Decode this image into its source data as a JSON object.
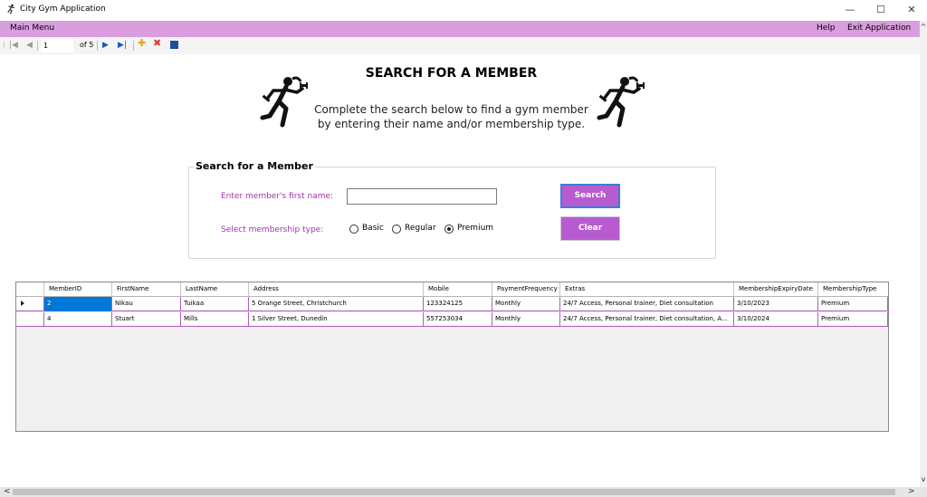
{
  "window": {
    "title": "City Gym Application",
    "icon": "runner-icon",
    "controls": {
      "minimize": "—",
      "maximize": "☐",
      "close": "✕"
    }
  },
  "menu": {
    "main": "Main Menu",
    "help": "Help",
    "exit": "Exit Application"
  },
  "navigator": {
    "position": "1",
    "count_label": "of 5",
    "icons": [
      "move-first-icon",
      "move-previous-icon",
      "move-next-icon",
      "move-last-icon",
      "add-new-icon",
      "delete-icon",
      "save-icon"
    ]
  },
  "header": {
    "title": "SEARCH FOR A MEMBER",
    "subtitle_line1": "Complete the search below to find a gym member",
    "subtitle_line2": "by entering their name and/or membership type."
  },
  "search": {
    "group_title": "Search for a Member",
    "first_name_label": "Enter member's first name:",
    "first_name_value": "",
    "membership_label": "Select membership type:",
    "options": [
      {
        "label": "Basic",
        "selected": false
      },
      {
        "label": "Regular",
        "selected": false
      },
      {
        "label": "Premium",
        "selected": true
      }
    ],
    "search_button": "Search",
    "clear_button": "Clear"
  },
  "grid": {
    "columns": [
      "MemberID",
      "FirstName",
      "LastName",
      "Address",
      "Mobile",
      "PaymentFrequency",
      "Extras",
      "MembershipExpiryDate",
      "MembershipType"
    ],
    "rows": [
      [
        "2",
        "Nikau",
        "Tuikaa",
        "5 Orange Street, Christchurch",
        "123324125",
        "Monthly",
        "24/7 Access, Personal trainer, Diet consultation",
        "3/10/2023",
        "Premium"
      ],
      [
        "4",
        "Stuart",
        "Mills",
        "1 Silver Street, Dunedin",
        "557253034",
        "Monthly",
        "24/7 Access, Personal trainer, Diet consultation, A...",
        "3/10/2024",
        "Premium"
      ]
    ]
  },
  "colors": {
    "menu_bar": "#d99ee0",
    "button": "#b95bd0",
    "label": "#a035a8",
    "selection": "#0078d7"
  }
}
